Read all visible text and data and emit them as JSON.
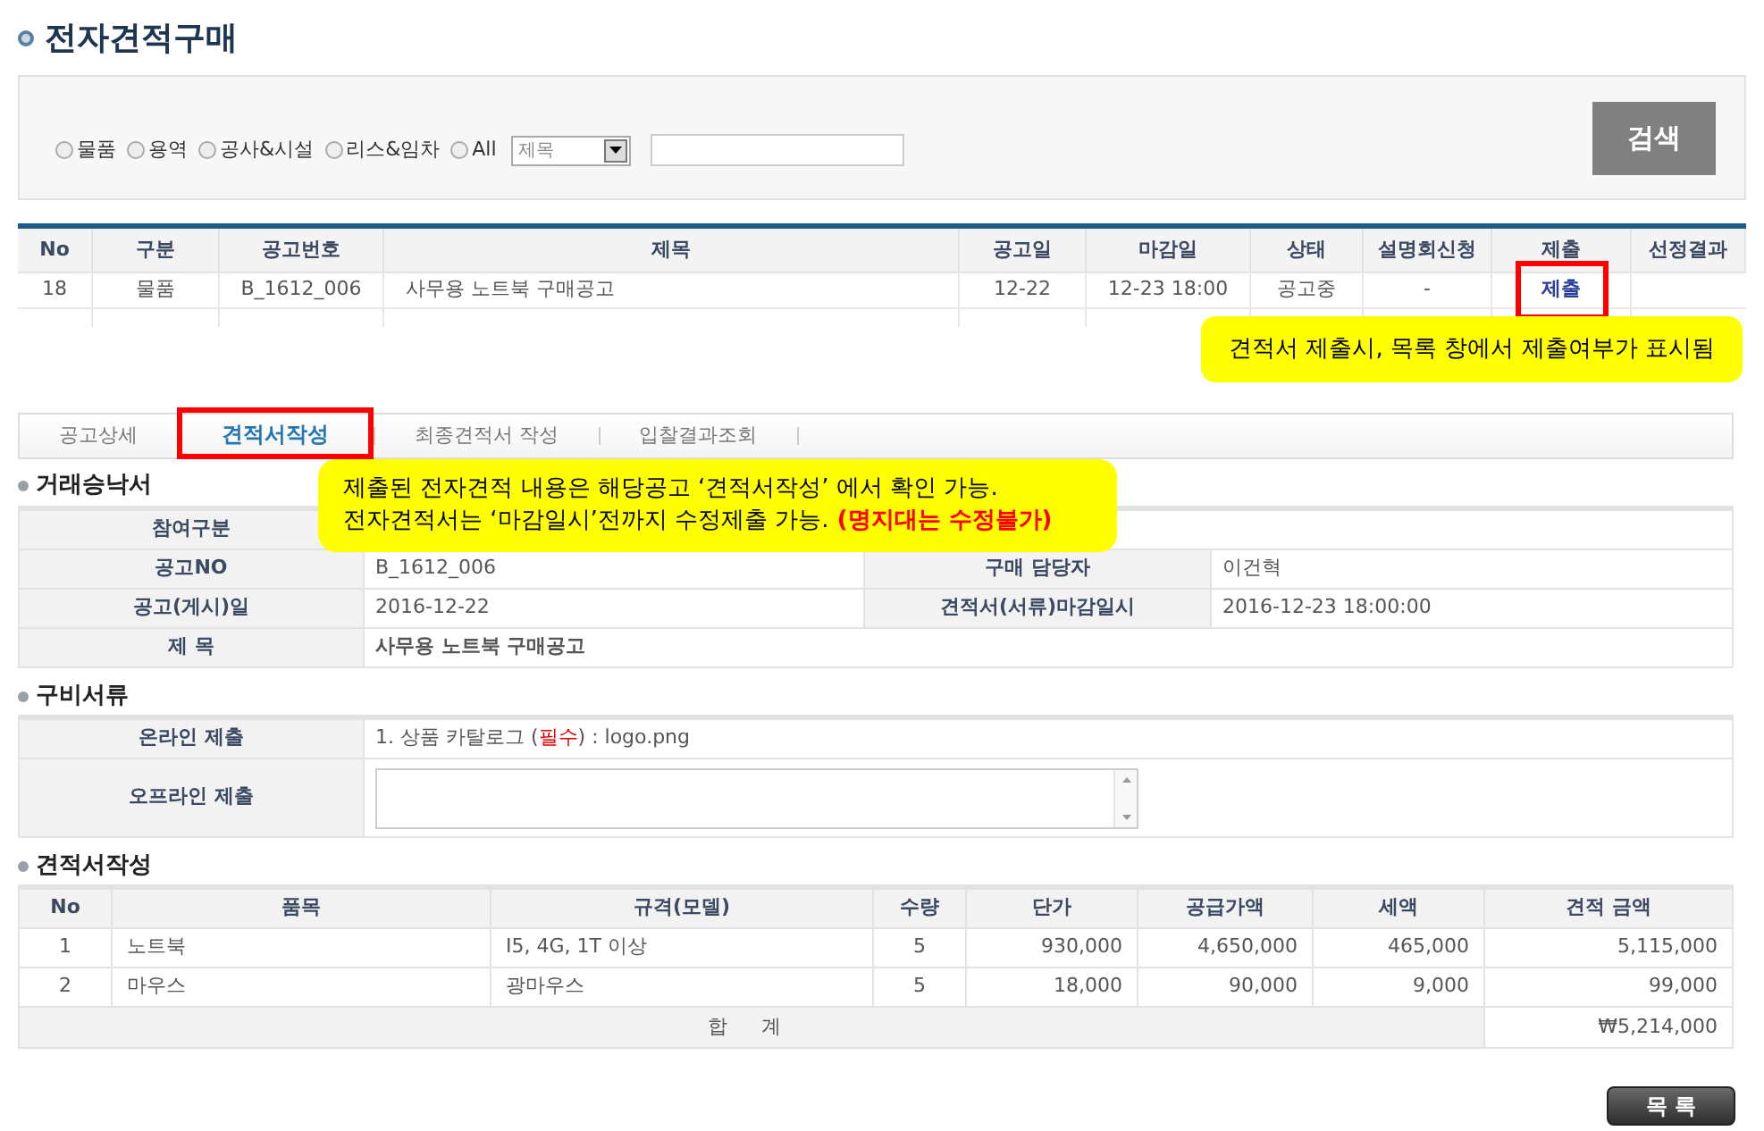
{
  "title": "전자견적구매",
  "search": {
    "radios": [
      {
        "label": "물품",
        "selected": false
      },
      {
        "label": "용역",
        "selected": false
      },
      {
        "label": "공사&시설",
        "selected": false
      },
      {
        "label": "리스&임차",
        "selected": false
      },
      {
        "label": "All",
        "selected": false
      }
    ],
    "field_select": "제목",
    "button": "검색"
  },
  "list_table": {
    "columns": [
      "No",
      "구분",
      "공고번호",
      "제목",
      "공고일",
      "마감일",
      "상태",
      "설명회신청",
      "제출",
      "선정결과"
    ],
    "rows": [
      {
        "no": "18",
        "type": "물품",
        "number": "B_1612_006",
        "title": "사무용 노트북 구매공고",
        "posted": "12-22",
        "deadline": "12-23 18:00",
        "status": "공고중",
        "briefing": "-",
        "submit": "제출",
        "highlighted": true
      }
    ]
  },
  "list_callout": "견적서 제출시, 목록 창에서 제출여부가 표시됨",
  "tabs": [
    {
      "label": "공고상세",
      "selected": false
    },
    {
      "label": "견적서작성",
      "selected": true
    },
    {
      "label": "최종견적서 작성",
      "selected": false
    },
    {
      "label": "입찰결과조회",
      "selected": false
    }
  ],
  "tab_callout": {
    "lines": [
      "제출된 전자견적 내용은 해당공고 ‘견적서작성’ 에서 확인 가능.",
      "전자견적서는 ‘마감일시’전까지  수정제출 가능."
    ],
    "emphasis": "(명지대는 수정불가)"
  },
  "acceptance": {
    "heading": "거래승낙서",
    "rows": [
      {
        "kind": "single",
        "label": "참여구분"
      },
      {
        "kind": "pair",
        "label": "공고NO",
        "value": "B_1612_006",
        "label_2": "구매 담당자",
        "value_2": "이건혁"
      },
      {
        "kind": "pair",
        "label": "공고(게시)일",
        "value": "2016-12-22",
        "label_2": "견적서(서류)마감일시",
        "value_2": "2016-12-23 18:00:00"
      },
      {
        "kind": "title",
        "label": "제 목",
        "value": "사무용 노트북 구매공고"
      }
    ]
  },
  "documents": {
    "heading": "구비서류",
    "online": {
      "label": "온라인 제출",
      "prefix": "1. 상품 카탈로그 (",
      "required": "필수",
      "suffix": ") : logo.png"
    },
    "offline": {
      "label": "오프라인 제출"
    }
  },
  "quote": {
    "heading": "견적서작성",
    "columns": [
      "No",
      "품목",
      "규격(모델)",
      "수량",
      "단가",
      "공급가액",
      "세액",
      "견적 금액"
    ],
    "rows": [
      {
        "cells": [
          "1",
          "노트북",
          "I5, 4G, 1T 이상",
          "5",
          "930,000",
          "4,650,000",
          "465,000",
          "5,115,000"
        ]
      },
      {
        "cells": [
          "2",
          "마우스",
          "광마우스",
          "5",
          "18,000",
          "90,000",
          "9,000",
          "99,000"
        ]
      }
    ],
    "total": {
      "label": "합 계",
      "value": "₩5,214,000"
    }
  },
  "list_button": "목 록"
}
